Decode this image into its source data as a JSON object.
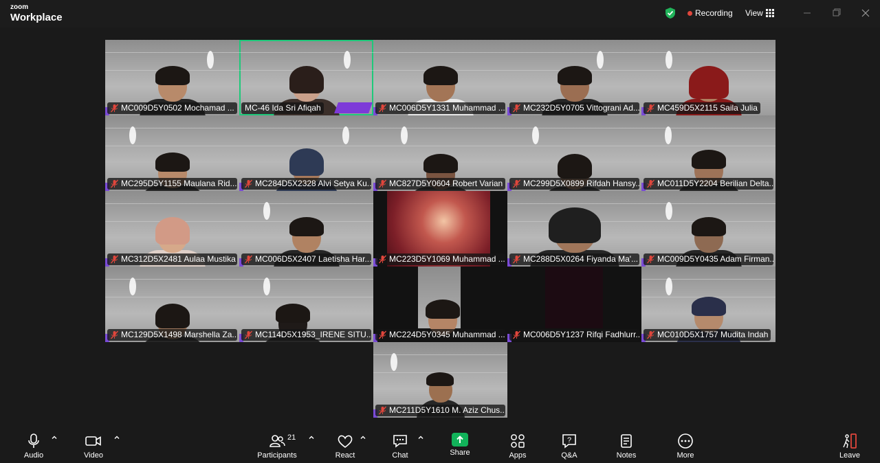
{
  "app": {
    "brand_small": "zoom",
    "brand_big": "Workplace",
    "recording_label": "Recording",
    "view_label": "View"
  },
  "participants_grid": [
    {
      "name": "MC009D5Y0502 Mochamad ...",
      "muted": true
    },
    {
      "name": "MC-46 Ida Sri Afiqah",
      "muted": false,
      "active": true
    },
    {
      "name": "MC006D5Y1331 Muhammad ...",
      "muted": true
    },
    {
      "name": "MC232D5Y0705 Vittograni Ad...",
      "muted": true
    },
    {
      "name": "MC459D5X2115 Saila Julia",
      "muted": true
    },
    {
      "name": "MC295D5Y1155 Maulana Rid...",
      "muted": true
    },
    {
      "name": "MC284D5X2328 Alvi Setya Ku...",
      "muted": true
    },
    {
      "name": "MC827D5Y0604 Robert Varian",
      "muted": true
    },
    {
      "name": "MC299D5X0899 Rifdah Hansy...",
      "muted": true
    },
    {
      "name": "MC011D5Y2204 Berilian Delta...",
      "muted": true
    },
    {
      "name": "MC312D5X2481 Aulaa Mustika",
      "muted": true
    },
    {
      "name": "MC006D5X2407 Laetisha Har...",
      "muted": true
    },
    {
      "name": "MC223D5Y1069 Muhammad ...",
      "muted": true
    },
    {
      "name": "MC288D5X0264 Fiyanda Ma'...",
      "muted": true
    },
    {
      "name": "MC009D5Y0435 Adam Firman...",
      "muted": true
    },
    {
      "name": "MC129D5X1498 Marshella Za...",
      "muted": true
    },
    {
      "name": "MC114D5X1953_IRENE SITU...",
      "muted": true
    },
    {
      "name": "MC224D5Y0345 Muhammad ...",
      "muted": true
    },
    {
      "name": "MC006D5Y1237 Rifqi Fadhlurr...",
      "muted": true
    },
    {
      "name": "MC010D5X1757 Mudita Indah",
      "muted": true
    },
    {
      "name": "MC211D5Y1610 M. Aziz Chus...",
      "muted": true
    }
  ],
  "toolbar": {
    "audio": "Audio",
    "video": "Video",
    "participants": "Participants",
    "participants_count": "21",
    "react": "React",
    "chat": "Chat",
    "share": "Share",
    "apps": "Apps",
    "qa": "Q&A",
    "notes": "Notes",
    "more": "More",
    "leave": "Leave"
  },
  "colors": {
    "background": "#1a1a1a",
    "active_speaker_border": "#1ec97a",
    "recording_dot": "#e0463c",
    "share_green": "#11b35a",
    "leave_red": "#e0463c",
    "muted_icon": "#e0463c"
  }
}
